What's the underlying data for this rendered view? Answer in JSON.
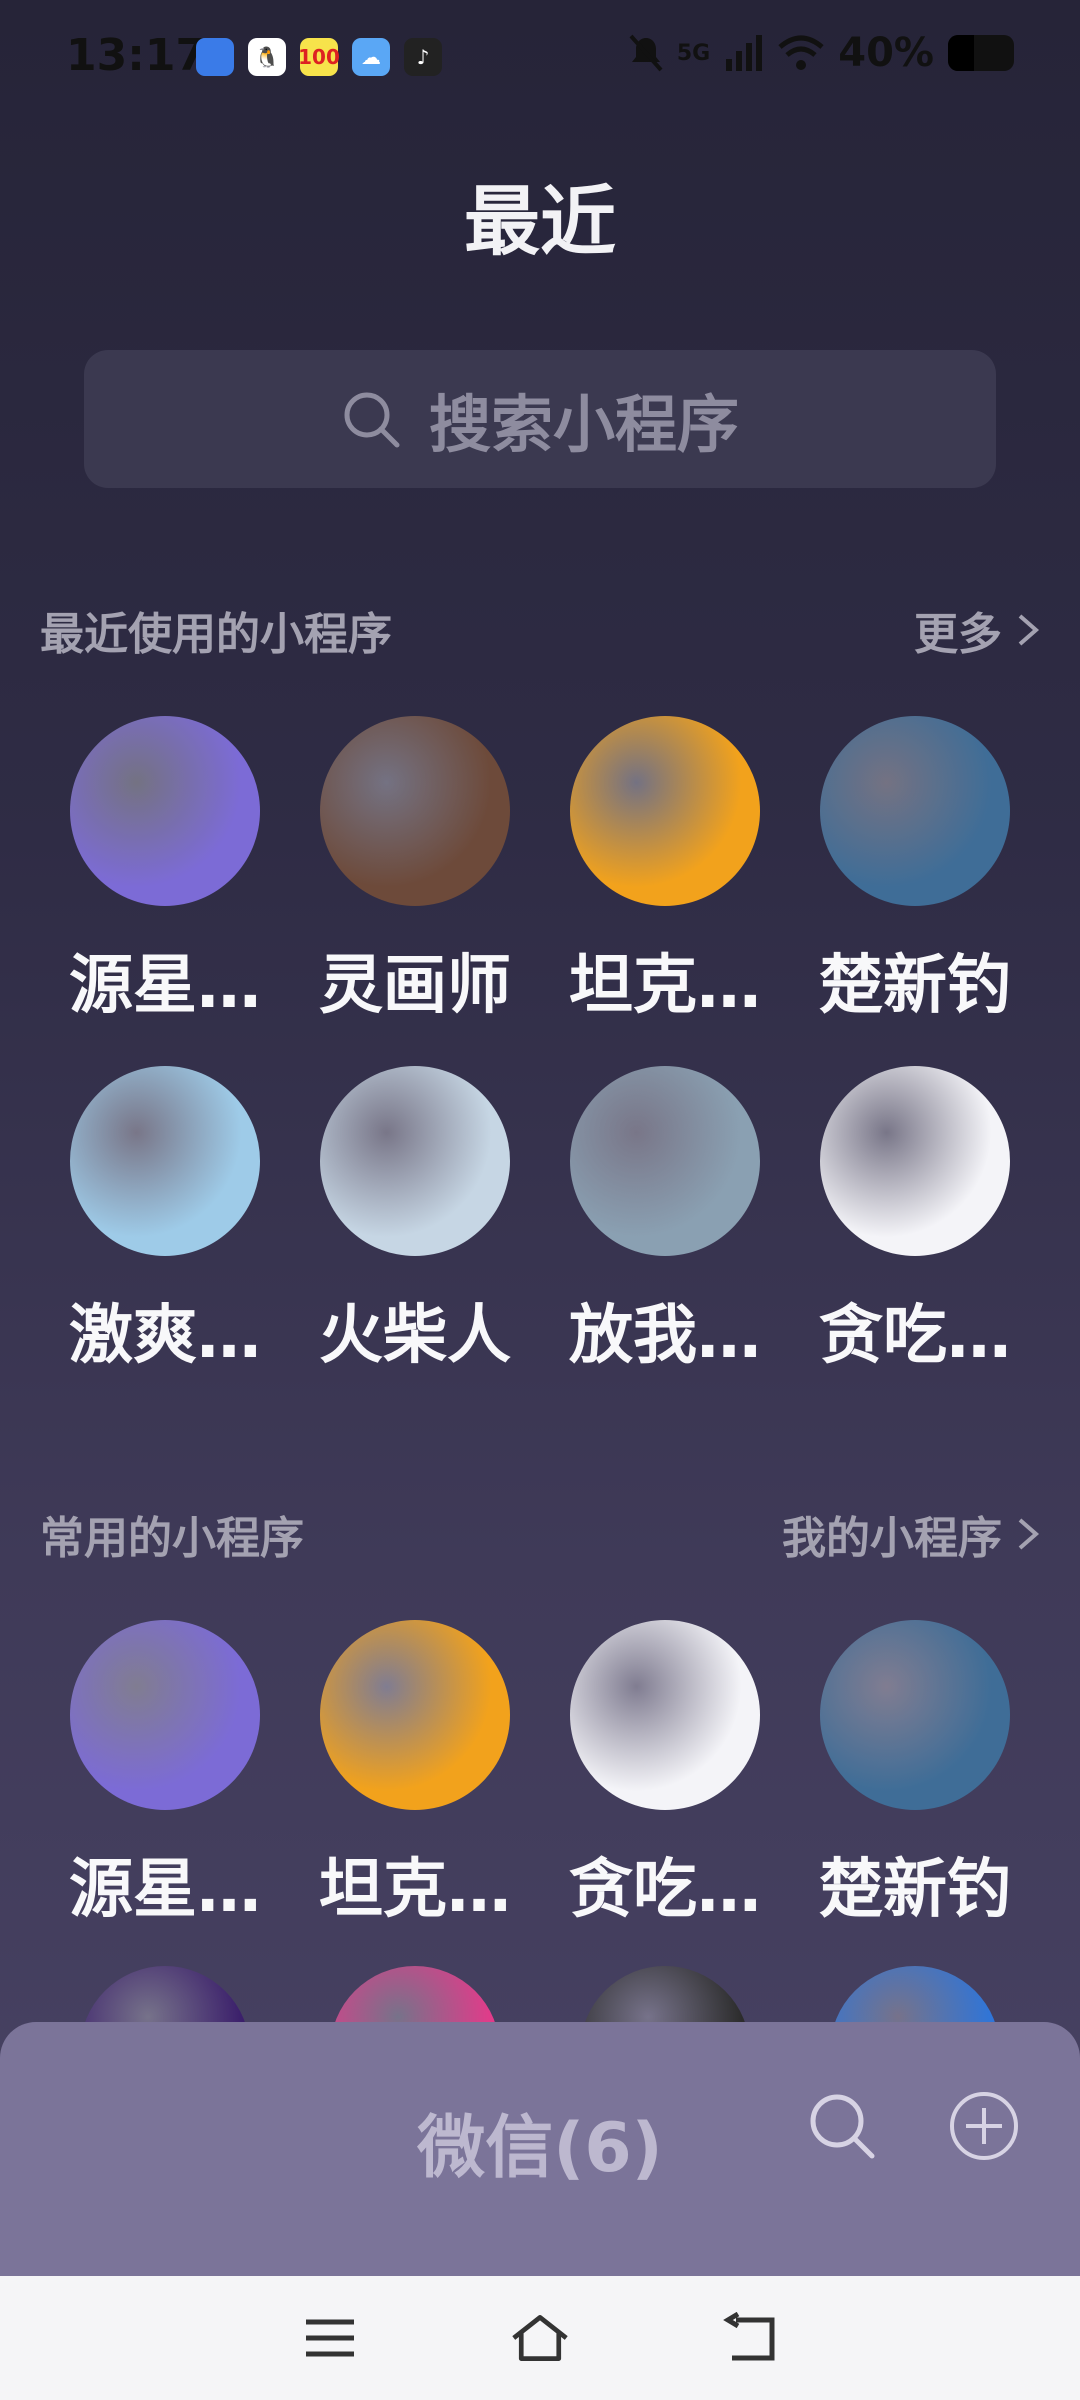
{
  "status_bar": {
    "time": "13:17",
    "network": "5G",
    "battery": "40%"
  },
  "title": "最近",
  "search": {
    "placeholder": "搜索小程序"
  },
  "recent": {
    "title": "最近使用的小程序",
    "more": "更多",
    "items": [
      {
        "name": "源星…",
        "icon": "anime-girl-avatar",
        "color": "#7c6bd6"
      },
      {
        "name": "灵画师",
        "icon": "anime-girl-2nd-anniv-avatar",
        "color": "#6d4a3a"
      },
      {
        "name": "坦克…",
        "icon": "tank-robot-avatar",
        "color": "#f2a21c"
      },
      {
        "name": "楚新钓",
        "icon": "fisherman-avatar",
        "color": "#3f6d97"
      },
      {
        "name": "激爽…",
        "icon": "sports-car-avatar",
        "color": "#9ecbe8"
      },
      {
        "name": "火柴人",
        "icon": "stickman-wall-avatar",
        "color": "#c6d6e4"
      },
      {
        "name": "放我…",
        "icon": "christmas-boy-avatar",
        "color": "#8aa0b2"
      },
      {
        "name": "贪吃…",
        "icon": "red-worm-avatar",
        "color": "#f4f4f8"
      }
    ]
  },
  "frequent": {
    "title": "常用的小程序",
    "more": "我的小程序",
    "items": [
      {
        "name": "源星…",
        "icon": "anime-girl-avatar",
        "color": "#7c6bd6"
      },
      {
        "name": "坦克…",
        "icon": "tank-robot-avatar",
        "color": "#f2a21c"
      },
      {
        "name": "贪吃…",
        "icon": "red-worm-avatar",
        "color": "#f4f4f8"
      },
      {
        "name": "楚新钓",
        "icon": "fisherman-avatar",
        "color": "#3f6d97"
      }
    ],
    "partial": [
      {
        "icon": "neon-game-avatar",
        "color": "#3b1f6b"
      },
      {
        "icon": "pink-burst-avatar",
        "color": "#e23b8a"
      },
      {
        "icon": "fruit-game-avatar",
        "color": "#2c2c2c"
      },
      {
        "icon": "money-game-avatar",
        "color": "#2f75d8"
      }
    ]
  },
  "bottom_panel": {
    "title": "微信(6)"
  },
  "nav": {
    "menu": "menu-icon",
    "home": "home-icon",
    "back": "back-icon"
  }
}
